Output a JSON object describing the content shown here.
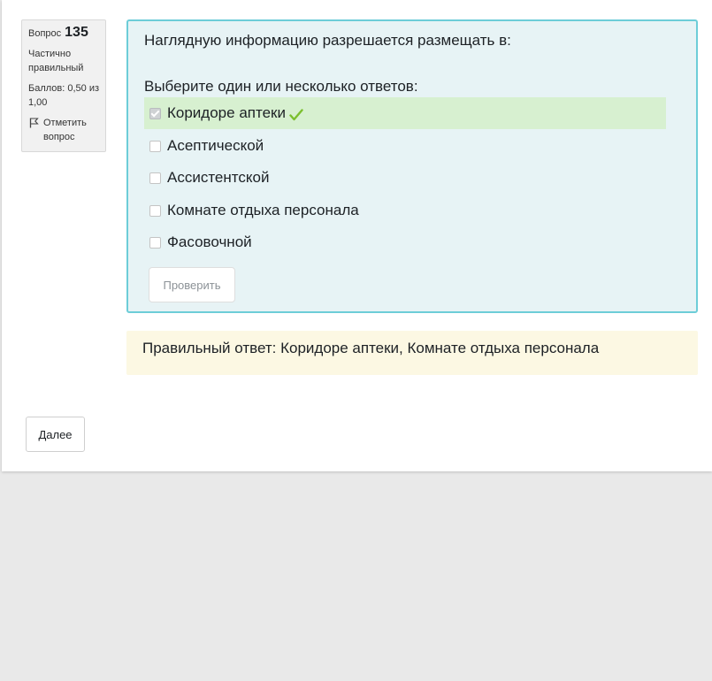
{
  "info": {
    "question_label": "Вопрос",
    "question_number": "135",
    "state": "Частично правильный",
    "grade": "Баллов: 0,50 из 1,00",
    "flag_label": "Отметить вопрос"
  },
  "question": {
    "text": "Наглядную информацию разрешается размещать в:",
    "prompt": "Выберите один или несколько ответов:",
    "answers": [
      {
        "label": "Коридоре аптеки",
        "checked": true,
        "correct": true
      },
      {
        "label": "Асептической",
        "checked": false
      },
      {
        "label": "Ассистентской",
        "checked": false
      },
      {
        "label": "Комнате отдыха персонала",
        "checked": false
      },
      {
        "label": "Фасовочной",
        "checked": false
      }
    ],
    "check_button": "Проверить"
  },
  "feedback": {
    "right_answer": "Правильный ответ: Коридоре аптеки, Комнате отдыха персонала"
  },
  "navigation": {
    "next_button": "Далее"
  },
  "colors": {
    "formulation_bg": "#e7f3f5",
    "formulation_border": "#6dcdd8",
    "correct_row_bg": "#d7f0d0",
    "tick": "#7bbf2e",
    "feedback_bg": "#fcf8e3"
  },
  "icons": {
    "flag": "flag-icon",
    "correct": "check-mark-icon"
  }
}
